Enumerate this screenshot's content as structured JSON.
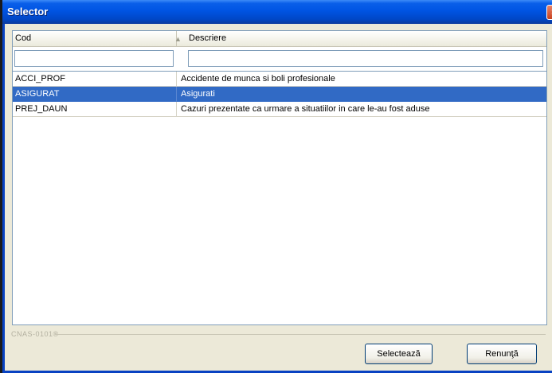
{
  "window": {
    "title": "Selector",
    "close_glyph": "×"
  },
  "grid": {
    "columns": [
      {
        "label": "Cod",
        "sort_icon": "▲"
      },
      {
        "label": "Descriere"
      }
    ],
    "filters": {
      "cod": "",
      "descriere": ""
    },
    "rows": [
      {
        "cod": "ACCI_PROF",
        "descriere": "Accidente de munca si boli profesionale",
        "selected": false
      },
      {
        "cod": "ASIGURAT",
        "descriere": "Asigurati",
        "selected": true
      },
      {
        "cod": "PREJ_DAUN",
        "descriere": "Cazuri prezentate ca urmare a situatiilor in care le-au fost aduse",
        "selected": false
      }
    ]
  },
  "status": {
    "label": "CNAS-0101®"
  },
  "buttons": {
    "select_label": "Selectează",
    "cancel_label": "Renunţă"
  },
  "colors": {
    "title_bar": "#0054e3",
    "selection": "#316ac5",
    "window_bg": "#ece9d8"
  }
}
